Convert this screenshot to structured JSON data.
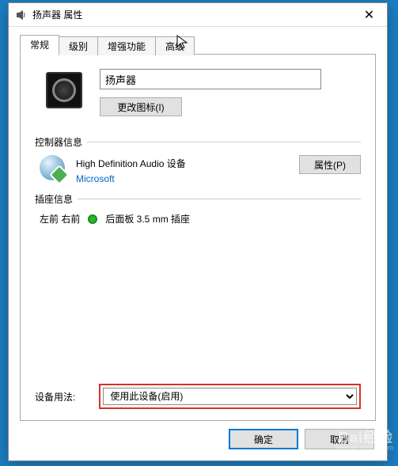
{
  "window": {
    "title": "扬声器 属性",
    "close_glyph": "✕"
  },
  "tabs": {
    "general": "常规",
    "levels": "级别",
    "enhancements": "增强功能",
    "advanced": "高级"
  },
  "device": {
    "name_value": "扬声器",
    "change_icon_btn": "更改图标(I)"
  },
  "controller": {
    "section_title": "控制器信息",
    "device_name": "High Definition Audio 设备",
    "manufacturer": "Microsoft",
    "properties_btn": "属性(P)"
  },
  "jack": {
    "section_title": "插座信息",
    "channels": "左前 右前",
    "description": "后面板 3.5 mm 插座"
  },
  "usage": {
    "label": "设备用法:",
    "selected": "使用此设备(启用)"
  },
  "footer": {
    "ok": "确定",
    "cancel": "取消"
  },
  "watermark": {
    "main": "Bai经验",
    "sub": "jingyan.baidu.com"
  }
}
